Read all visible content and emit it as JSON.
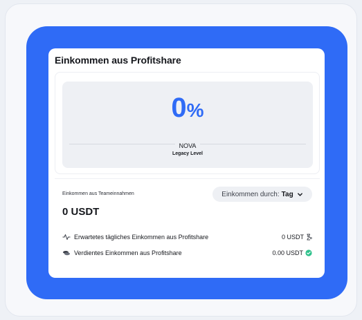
{
  "card": {
    "title": "Einkommen aus Profitshare"
  },
  "level": {
    "percent_number": "0",
    "percent_symbol": "%",
    "name": "NOVA",
    "label": "Legacy Level"
  },
  "team_income": {
    "label": "Einkommen aus Teameinnahmen",
    "amount": "0 USDT"
  },
  "filter": {
    "label": "Einkommen durch:",
    "value": "Tag"
  },
  "rows": [
    {
      "label": "Erwartetes tägliches Einkommen aus Profitshare",
      "value": "0 USDT",
      "icon": "activity-icon",
      "status_icon": "hourglass-icon"
    },
    {
      "label": "Verdientes Einkommen aus Profitshare",
      "value": "0.00 USDT",
      "icon": "coins-icon",
      "status_icon": "check-circle-icon"
    }
  ],
  "colors": {
    "accent": "#2f6bf6",
    "success": "#2fc18c",
    "panel": "#eef0f4"
  }
}
